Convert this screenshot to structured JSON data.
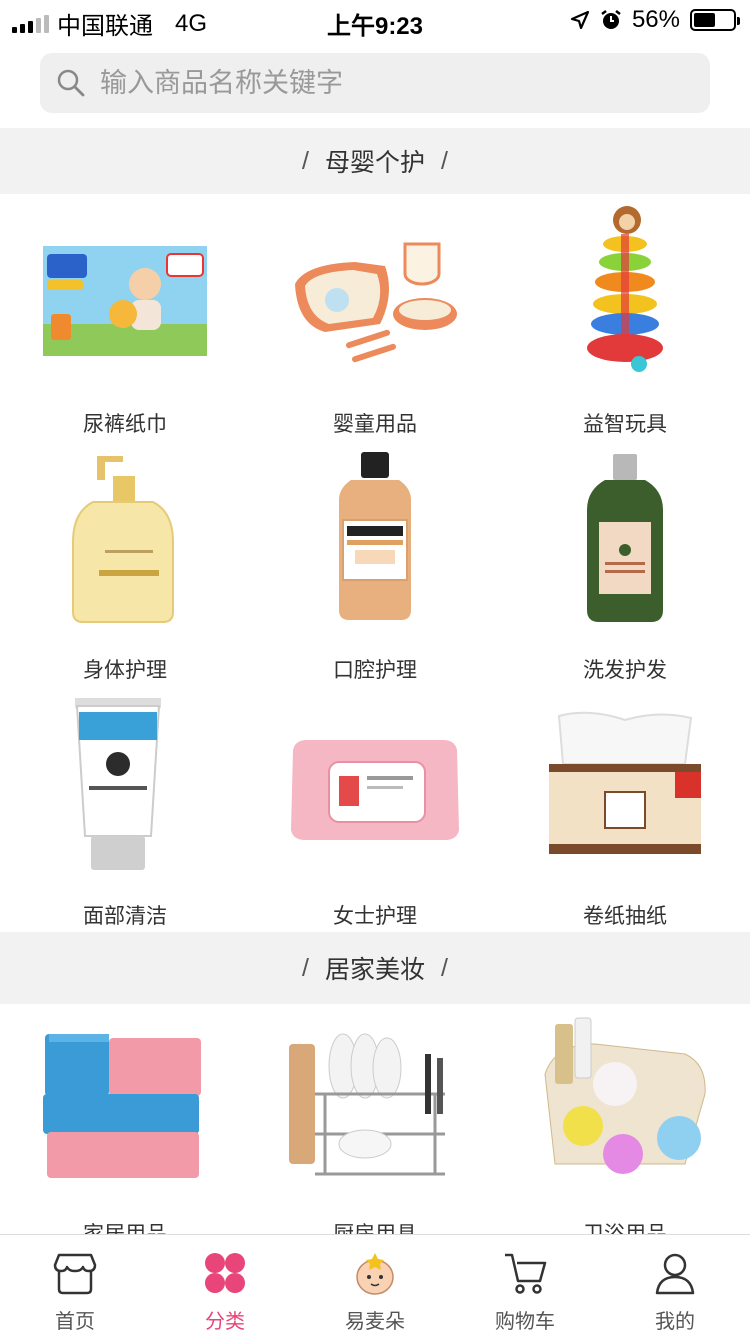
{
  "status_bar": {
    "carrier": "中国联通",
    "network": "4G",
    "time": "上午9:23",
    "battery_text": "56%",
    "battery_level": 0.56
  },
  "search": {
    "placeholder": "输入商品名称关键字",
    "icon": "search-icon"
  },
  "sections": [
    {
      "title": "母婴个护",
      "items": [
        {
          "label": "尿裤纸巾"
        },
        {
          "label": "婴童用品"
        },
        {
          "label": "益智玩具"
        },
        {
          "label": "身体护理"
        },
        {
          "label": "口腔护理"
        },
        {
          "label": "洗发护发"
        },
        {
          "label": "面部清洁"
        },
        {
          "label": "女士护理"
        },
        {
          "label": "卷纸抽纸"
        }
      ]
    },
    {
      "title": "居家美妆",
      "items": [
        {
          "label": "家居用品"
        },
        {
          "label": "厨房用具"
        },
        {
          "label": "卫浴用品"
        }
      ]
    }
  ],
  "tabs": [
    {
      "label": "首页",
      "icon": "shop-icon",
      "active": false
    },
    {
      "label": "分类",
      "icon": "category-icon",
      "active": true
    },
    {
      "label": "易麦朵",
      "icon": "mascot-icon",
      "active": false
    },
    {
      "label": "购物车",
      "icon": "cart-icon",
      "active": false
    },
    {
      "label": "我的",
      "icon": "user-icon",
      "active": false
    }
  ],
  "colors": {
    "accent": "#e8457a",
    "section_bg": "#f2f2f2"
  }
}
